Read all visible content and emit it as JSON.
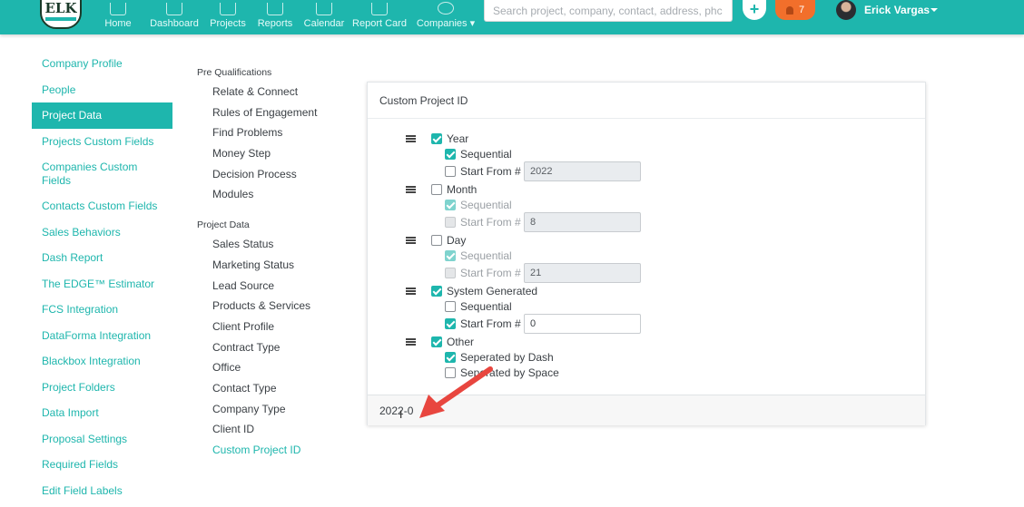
{
  "topbar": {
    "logo_text": "ELK",
    "nav": [
      "Home",
      "Dashboard",
      "Projects",
      "Reports",
      "Calendar",
      "Report Card",
      "Companies ▾"
    ],
    "search_placeholder": "Search project, company, contact, address, phc",
    "plus_label": "+",
    "notifications_count": "7",
    "user_name": "Erick Vargas"
  },
  "left_menu": [
    "Company Profile",
    "People",
    "Project Data",
    "Projects Custom Fields",
    "Companies Custom Fields",
    "Contacts Custom Fields",
    "Sales Behaviors",
    "Dash Report",
    "The EDGE™ Estimator",
    "FCS Integration",
    "DataForma Integration",
    "Blackbox Integration",
    "Project Folders",
    "Data Import",
    "Proposal Settings",
    "Required Fields",
    "Edit Field Labels"
  ],
  "left_menu_active": "Project Data",
  "mid_menu": {
    "group1_title": "Pre Qualifications",
    "group1_items": [
      "Relate & Connect",
      "Rules of Engagement",
      "Find Problems",
      "Money Step",
      "Decision Process",
      "Modules"
    ],
    "group2_title": "Project Data",
    "group2_items": [
      "Sales Status",
      "Marketing Status",
      "Lead Source",
      "Products & Services",
      "Client Profile",
      "Contract Type",
      "Office",
      "Contact Type",
      "Company Type",
      "Client ID",
      "Custom Project ID"
    ],
    "active": "Custom Project ID"
  },
  "card": {
    "title": "Custom Project ID",
    "groups": [
      {
        "label": "Year",
        "checked": true,
        "sequential": {
          "label": "Sequential",
          "checked": true,
          "disabled": false
        },
        "start": {
          "label": "Start From #",
          "checked": false,
          "disabled": false,
          "value": "2022",
          "input_enabled": false
        }
      },
      {
        "label": "Month",
        "checked": false,
        "sequential": {
          "label": "Sequential",
          "checked": true,
          "disabled": true
        },
        "start": {
          "label": "Start From #",
          "checked": false,
          "disabled": true,
          "value": "8",
          "input_enabled": false
        }
      },
      {
        "label": "Day",
        "checked": false,
        "sequential": {
          "label": "Sequential",
          "checked": true,
          "disabled": true
        },
        "start": {
          "label": "Start From #",
          "checked": false,
          "disabled": true,
          "value": "21",
          "input_enabled": false
        }
      },
      {
        "label": "System Generated",
        "checked": true,
        "sequential": {
          "label": "Sequential",
          "checked": false,
          "disabled": false
        },
        "start": {
          "label": "Start From #",
          "checked": true,
          "disabled": false,
          "value": "0",
          "input_enabled": true
        }
      }
    ],
    "other": {
      "label": "Other",
      "checked": true,
      "options": [
        {
          "label": "Seperated by Dash",
          "checked": true
        },
        {
          "label": "Seperated by Space",
          "checked": false
        }
      ]
    },
    "preview": "2022-0"
  },
  "colors": {
    "accent": "#1eb6ad",
    "notif": "#f26f2b",
    "arrow": "#e8463f"
  }
}
